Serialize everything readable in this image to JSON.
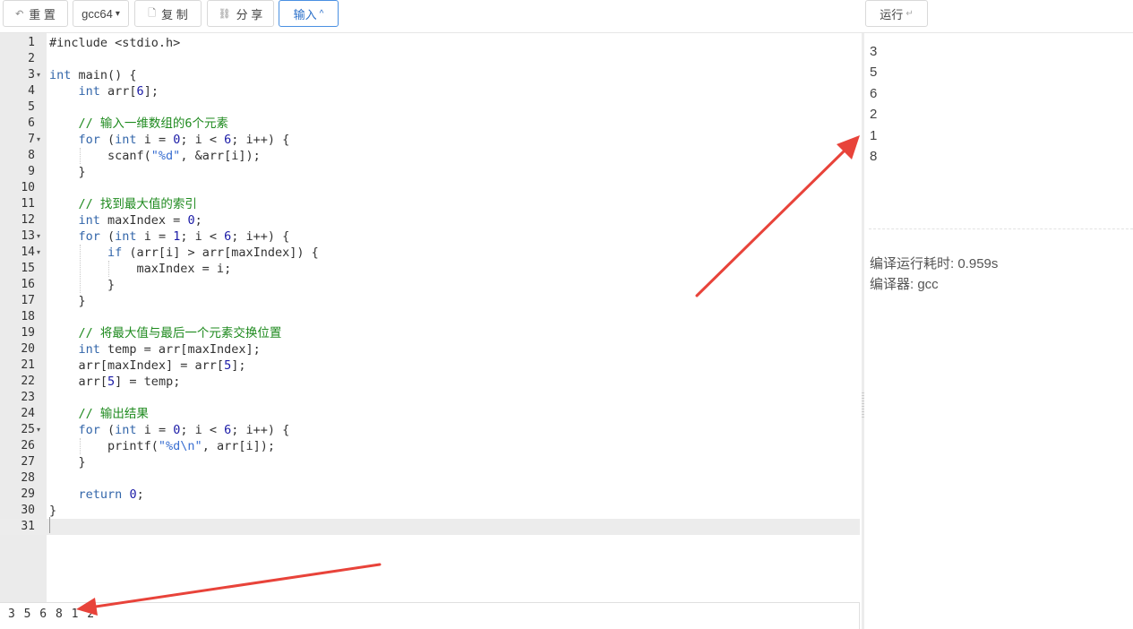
{
  "toolbar": {
    "reset_label": "重 置",
    "compiler_label": "gcc64",
    "copy_label": "复 制",
    "share_label": "分 享",
    "input_label": "输入",
    "run_label": "运行"
  },
  "icons": {
    "reset": "undo-icon",
    "compiler_dropdown": "chevron-down-icon",
    "copy": "file-icon",
    "share": "link-icon",
    "input_toggle": "chevron-up-icon",
    "run": "enter-key-icon"
  },
  "code": {
    "lines": [
      "#include <stdio.h>",
      "",
      "int main() {",
      "    int arr[6];",
      "",
      "    // 输入一维数组的6个元素",
      "    for (int i = 0; i < 6; i++) {",
      "        scanf(\"%d\", &arr[i]);",
      "    }",
      "",
      "    // 找到最大值的索引",
      "    int maxIndex = 0;",
      "    for (int i = 1; i < 6; i++) {",
      "        if (arr[i] > arr[maxIndex]) {",
      "            maxIndex = i;",
      "        }",
      "    }",
      "",
      "    // 将最大值与最后一个元素交换位置",
      "    int temp = arr[maxIndex];",
      "    arr[maxIndex] = arr[5];",
      "    arr[5] = temp;",
      "",
      "    // 输出结果",
      "    for (int i = 0; i < 6; i++) {",
      "        printf(\"%d\\n\", arr[i]);",
      "    }",
      "",
      "    return 0;",
      "}",
      ""
    ],
    "fold_lines": [
      3,
      7,
      13,
      14,
      25
    ],
    "active_line": 31
  },
  "stdin": {
    "value": "3 5 6 8 1 2"
  },
  "output": {
    "lines": [
      "3",
      "5",
      "6",
      "2",
      "1",
      "8"
    ]
  },
  "meta": {
    "time_text": "编译运行耗时: 0.959s",
    "compiler_text": "编译器: gcc"
  },
  "colors": {
    "accent": "#4a90e2",
    "arrow": "#e8433a",
    "keyword": "#3366aa",
    "comment": "#1e8a1e",
    "string": "#3a6fd1"
  }
}
